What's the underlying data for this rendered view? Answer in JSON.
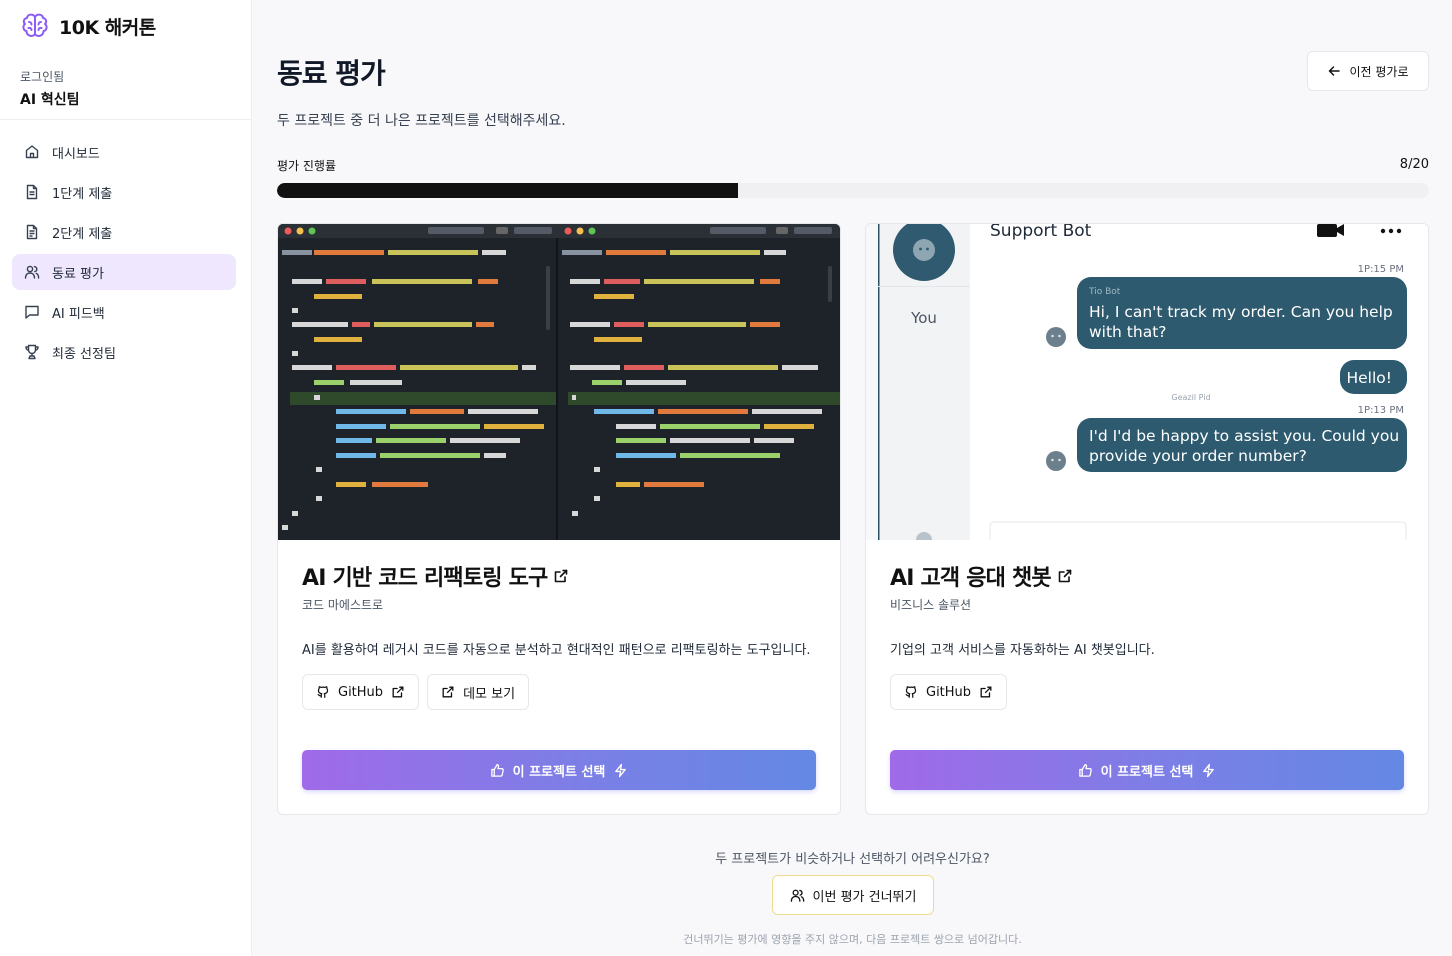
{
  "app": {
    "name": "10K 해커톤",
    "accent": "#8b5cf6"
  },
  "user": {
    "status_label": "로그인됨",
    "team": "AI 혁신팀"
  },
  "sidebar": {
    "items": [
      {
        "label": "대시보드",
        "icon": "home-icon"
      },
      {
        "label": "1단계 제출",
        "icon": "file-icon"
      },
      {
        "label": "2단계 제출",
        "icon": "file-text-icon"
      },
      {
        "label": "동료 평가",
        "icon": "users-icon",
        "active": true
      },
      {
        "label": "AI 피드백",
        "icon": "message-square-icon"
      },
      {
        "label": "최종 선정팀",
        "icon": "trophy-icon"
      }
    ]
  },
  "header": {
    "title": "동료 평가",
    "subtitle": "두 프로젝트 중 더 나은 프로젝트를 선택해주세요.",
    "back_label": "이전 평가로"
  },
  "progress": {
    "label": "평가 진행률",
    "current": 8,
    "total": 20,
    "count_text": "8/20"
  },
  "projects": [
    {
      "title": "AI 기반 코드 리팩토링 도구",
      "team": "코드 마에스트로",
      "description": "AI를 활용하여 레거시 코드를 자동으로 분석하고 현대적인 패턴으로 리팩토링하는 도구입니다.",
      "links": [
        {
          "label": "GitHub",
          "icon": "github-icon"
        },
        {
          "label": "데모 보기",
          "icon": "external-link-icon"
        }
      ],
      "select_label": "이 프로젝트 선택"
    },
    {
      "title": "AI 고객 응대 챗봇",
      "team": "비즈니스 솔루션",
      "description": "기업의 고객 서비스를 자동화하는 AI 챗봇입니다.",
      "links": [
        {
          "label": "GitHub",
          "icon": "github-icon"
        }
      ],
      "select_label": "이 프로젝트 선택"
    }
  ],
  "chat_preview": {
    "header": "Support Bot",
    "you_label": "You",
    "time1": "1P:15 PM",
    "sender1": "Tio Bot",
    "msg1_line1": "Hi, I can't track my order. Can you help",
    "msg1_line2": "with that?",
    "msg2": "Hello!",
    "mid_label": "Geazil Pid",
    "time2": "1P:13 PM",
    "msg3_line1": "I'd I'd be happy to assist you. Could you",
    "msg3_line2": "provide your order number?"
  },
  "footer": {
    "question": "두 프로젝트가 비슷하거나 선택하기 어려우신가요?",
    "skip_label": "이번 평가 건너뛰기",
    "note": "건너뛰기는 평가에 영향을 주지 않으며, 다음 프로젝트 쌍으로 넘어갑니다."
  }
}
